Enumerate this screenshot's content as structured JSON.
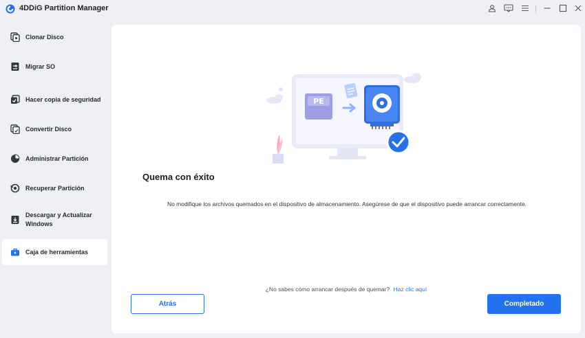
{
  "app": {
    "title": "4DDiG Partition Manager",
    "icons": [
      "user-icon",
      "feedback-icon",
      "menu-icon",
      "minimize-icon",
      "maximize-icon",
      "close-icon"
    ]
  },
  "sidebar": {
    "items": [
      {
        "label": "Clonar Disco",
        "icon": "clone-disk-icon"
      },
      {
        "label": "Migrar SO",
        "icon": "migrate-os-icon"
      },
      {
        "label": "Hacer copia de seguridad",
        "icon": "backup-icon"
      },
      {
        "label": "Convertir Disco",
        "icon": "convert-disk-icon"
      },
      {
        "label": "Administrar Partición",
        "icon": "partition-icon"
      },
      {
        "label": "Recuperar Partición",
        "icon": "recover-partition-icon"
      },
      {
        "label": "Descargar y Actualizar Windows",
        "icon": "windows-update-icon"
      },
      {
        "label": "Caja de herramientas",
        "icon": "toolbox-icon",
        "active": true
      }
    ]
  },
  "main": {
    "illustration": {
      "pe_label": "PE"
    },
    "heading": "Quema con éxito",
    "description": "No modifique los archivos quemados en el dispositivo de almacenamiento. Asegúrese de que el dispositivo puede arrancar correctamente.",
    "help_text": "¿No sabes cómo arrancar después de quemar?",
    "help_link": "Haz clic aquí",
    "back_label": "Atrás",
    "done_label": "Completado"
  },
  "colors": {
    "accent": "#2370f0",
    "background": "#eef0f5",
    "panel": "#ffffff"
  }
}
